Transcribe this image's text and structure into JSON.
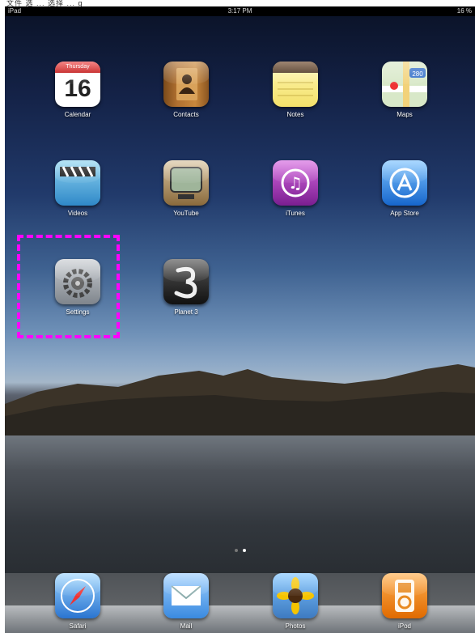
{
  "top_strip_text": "文件 选 ... 选择 ... g",
  "status": {
    "carrier": "iPad",
    "time": "3:17 PM",
    "battery": "16 %"
  },
  "apps": [
    {
      "label": "Calendar",
      "calendar_day": "Thursday",
      "calendar_date": "16",
      "icon": "calendar-icon"
    },
    {
      "label": "Contacts",
      "icon": "contacts-icon"
    },
    {
      "label": "Notes",
      "icon": "notes-icon"
    },
    {
      "label": "Maps",
      "map_badge": "280",
      "icon": "maps-icon"
    },
    {
      "label": "Videos",
      "icon": "videos-icon"
    },
    {
      "label": "YouTube",
      "icon": "youtube-icon"
    },
    {
      "label": "iTunes",
      "icon": "itunes-icon"
    },
    {
      "label": "App Store",
      "icon": "app-store-icon"
    },
    {
      "label": "Settings",
      "icon": "settings-gear-icon"
    },
    {
      "label": "Planet 3",
      "icon": "planet-3-icon"
    }
  ],
  "dock": [
    {
      "label": "Safari",
      "icon": "safari-compass-icon"
    },
    {
      "label": "Mail",
      "icon": "mail-envelope-icon"
    },
    {
      "label": "Photos",
      "icon": "photos-sunflower-icon"
    },
    {
      "label": "iPod",
      "icon": "ipod-icon"
    }
  ],
  "page_indicator": {
    "pages": 2,
    "current": 2
  },
  "colors": {
    "highlight": "#ff00ff"
  }
}
